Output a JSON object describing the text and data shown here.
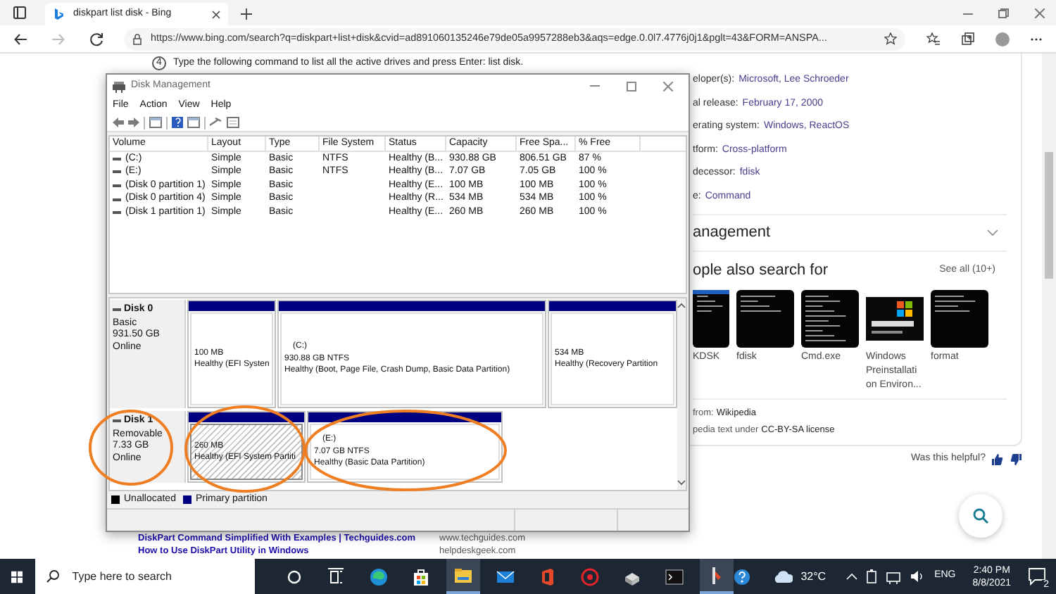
{
  "browser": {
    "tab_title": "diskpart list disk - Bing",
    "address": "https://www.bing.com/search?q=diskpart+list+disk&cvid=ad891060135246e79de05a9957288eb3&aqs=edge.0.0l7.4776j0j1&pglt=43&FORM=ANSPA..."
  },
  "page": {
    "step": {
      "number": "4",
      "text": "Type the following command to list all the active drives and press Enter: list disk."
    },
    "infobox": [
      {
        "label": "eloper(s):",
        "value": "Microsoft, Lee Schroeder"
      },
      {
        "label": "al release:",
        "value": "February 17, 2000"
      },
      {
        "label": "erating system:",
        "value": "Windows, ReactOS"
      },
      {
        "label": "tform:",
        "value": "Cross-platform"
      },
      {
        "label": "decessor:",
        "value": "fdisk"
      },
      {
        "label": "e:",
        "value": "Command"
      }
    ],
    "section": "anagement",
    "people_also": {
      "heading": "ople also search for",
      "see_all": "See all (10+)",
      "items": [
        {
          "label": "KDSK"
        },
        {
          "label": "fdisk"
        },
        {
          "label": "Cmd.exe"
        },
        {
          "label": "Windows Preinstallati on Environ..."
        },
        {
          "label": "format"
        }
      ]
    },
    "source": {
      "label": "from:",
      "link": "Wikipedia"
    },
    "license": {
      "label": "pedia text under",
      "link": "CC-BY-SA license"
    },
    "helpful": "Was this helpful?",
    "results": [
      {
        "title": "DiskPart Command Simplified With Examples | Techguides.com",
        "site": "www.techguides.com"
      },
      {
        "title": "How to Use DiskPart Utility in Windows",
        "site": "helpdeskgeek.com"
      }
    ]
  },
  "disk_management": {
    "title": "Disk Management",
    "menu": [
      "File",
      "Action",
      "View",
      "Help"
    ],
    "columns": [
      "Volume",
      "Layout",
      "Type",
      "File System",
      "Status",
      "Capacity",
      "Free Spa...",
      "% Free"
    ],
    "rows": [
      [
        "(C:)",
        "Simple",
        "Basic",
        "NTFS",
        "Healthy (B...",
        "930.88 GB",
        "806.51 GB",
        "87 %"
      ],
      [
        "(E:)",
        "Simple",
        "Basic",
        "NTFS",
        "Healthy (B...",
        "7.07 GB",
        "7.05 GB",
        "100 %"
      ],
      [
        "(Disk 0 partition 1)",
        "Simple",
        "Basic",
        "",
        "Healthy (E...",
        "100 MB",
        "100 MB",
        "100 %"
      ],
      [
        "(Disk 0 partition 4)",
        "Simple",
        "Basic",
        "",
        "Healthy (R...",
        "534 MB",
        "534 MB",
        "100 %"
      ],
      [
        "(Disk 1 partition 1)",
        "Simple",
        "Basic",
        "",
        "Healthy (E...",
        "260 MB",
        "260 MB",
        "100 %"
      ]
    ],
    "disks": [
      {
        "name": "Disk 0",
        "type": "Basic",
        "size": "931.50 GB",
        "status": "Online",
        "partitions": [
          {
            "size": "100 MB",
            "status": "Healthy (EFI Systen",
            "selected": false
          },
          {
            "label": "(C:)",
            "size": "930.88 GB NTFS",
            "status": "Healthy (Boot, Page File, Crash Dump, Basic Data Partition)",
            "selected": false
          },
          {
            "size": "534 MB",
            "status": "Healthy (Recovery Partition",
            "selected": false
          }
        ]
      },
      {
        "name": "Disk 1",
        "type": "Removable",
        "size": "7.33 GB",
        "status": "Online",
        "partitions": [
          {
            "size": "260 MB",
            "status": "Healthy (EFI System Partiti",
            "selected": true
          },
          {
            "label": "(E:)",
            "size": "7.07 GB NTFS",
            "status": "Healthy (Basic Data Partition)",
            "selected": false
          }
        ]
      }
    ],
    "legend": [
      {
        "label": "Unallocated",
        "color": "#000000"
      },
      {
        "label": "Primary partition",
        "color": "#000080"
      }
    ]
  },
  "taskbar": {
    "search_placeholder": "Type here to search",
    "weather": "32°C",
    "language": "ENG",
    "time": "2:40 PM",
    "date": "8/8/2021",
    "notifications": "2"
  }
}
